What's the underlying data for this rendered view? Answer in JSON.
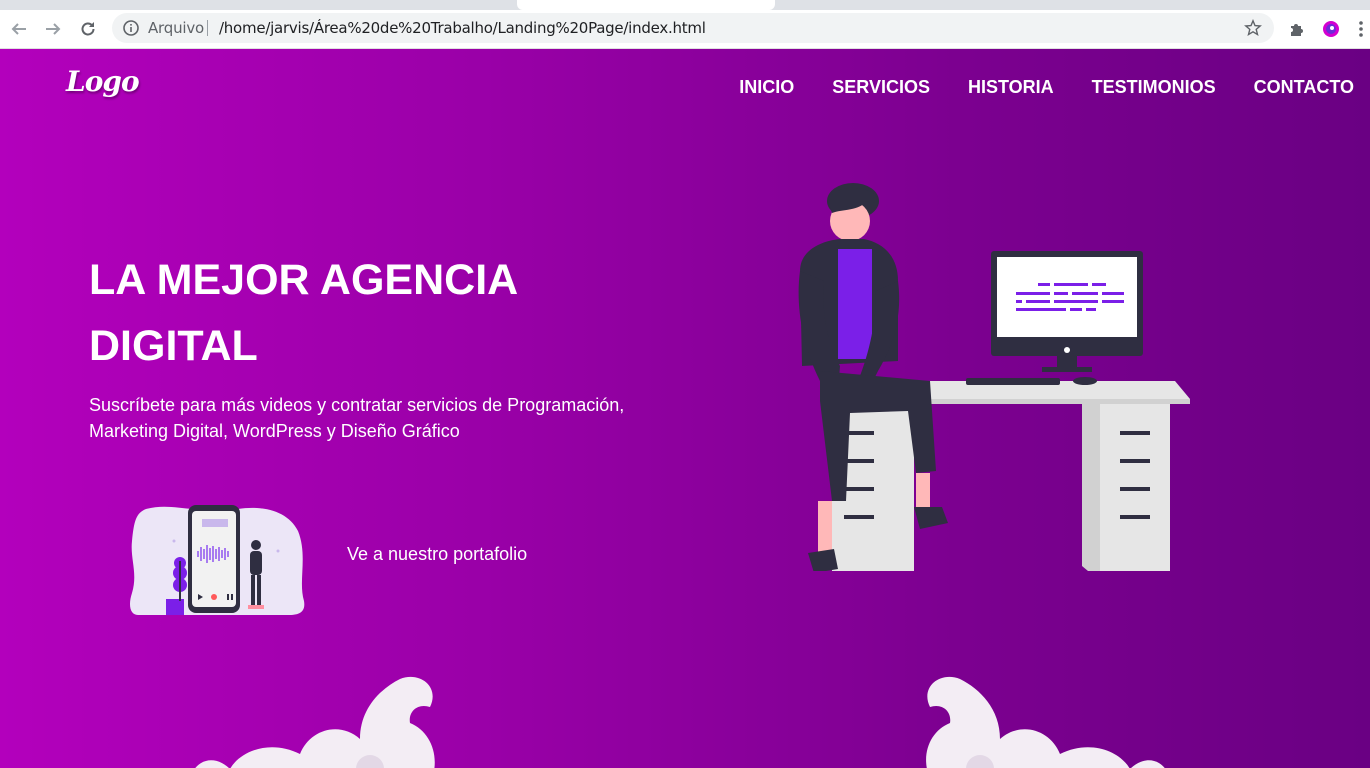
{
  "browser": {
    "omnibox": {
      "label": "Arquivo",
      "url": "/home/jarvis/Área%20de%20Trabalho/Landing%20Page/index.html"
    },
    "icons": [
      "back-arrow-icon",
      "forward-arrow-icon",
      "reload-icon",
      "info-icon",
      "star-icon",
      "puzzle-icon",
      "profile-icon",
      "kebab-menu-icon"
    ]
  },
  "header": {
    "logo": "Logo",
    "nav": [
      "INICIO",
      "SERVICIOS",
      "HISTORIA",
      "TESTIMONIOS",
      "CONTACTO"
    ]
  },
  "hero": {
    "title": "LA MEJOR AGENCIA DIGITAL",
    "subtitle": "Suscríbete para más videos y contratar servicios de Programación, Marketing Digital, WordPress y Diseño Gráfico",
    "portfolio_link": "Ve a nuestro portafolio"
  },
  "colors": {
    "gradient_start": "#b300bc",
    "gradient_end": "#6a0083",
    "accent_purple": "#7b1fe8",
    "dark_figure": "#2f2e41"
  }
}
